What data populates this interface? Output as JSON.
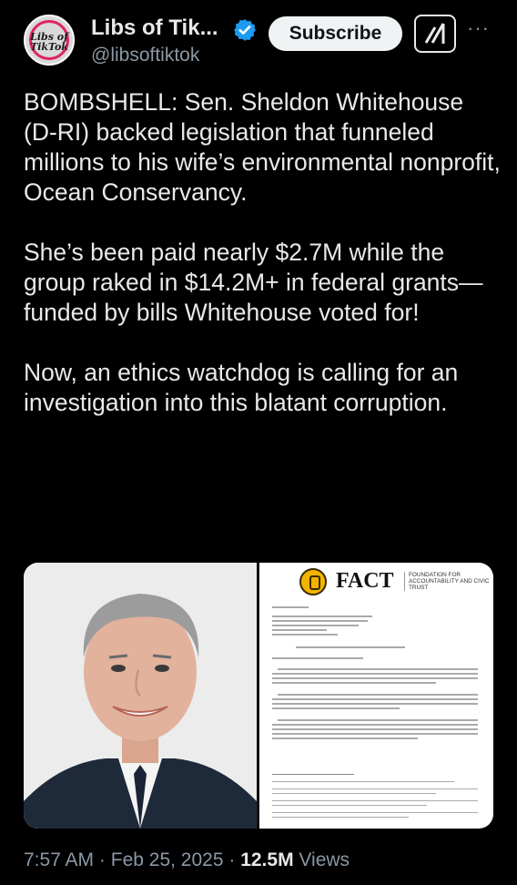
{
  "account": {
    "display_name": "Libs of Tik...",
    "handle": "@libsoftiktok",
    "avatar_text": "Libs of TikTok",
    "verified": true
  },
  "actions": {
    "subscribe_label": "Subscribe",
    "grok_icon": "grok-icon",
    "more_label": "···"
  },
  "tweet": {
    "paragraphs": [
      "BOMBSHELL: Sen. Sheldon Whitehouse (D-RI) backed legislation that funneled millions to his wife’s environmental nonprofit, Ocean Conservancy.",
      "She’s been paid nearly $2.7M while the group raked in $14.2M+ in federal grants—funded by bills Whitehouse voted for!",
      "Now, an ethics watchdog is calling for an investigation into this blatant corruption."
    ]
  },
  "media": {
    "photo_subject": "portrait-photo",
    "document": {
      "logo_word": "FACT",
      "logo_subtitle": "FOUNDATION FOR ACCOUNTABILITY AND CIVIC TRUST"
    }
  },
  "meta": {
    "time": "7:57 AM",
    "sep1": "·",
    "date": "Feb 25, 2025",
    "sep2": "·",
    "views_count": "12.5M",
    "views_label": "Views"
  },
  "colors": {
    "background": "#000000",
    "text": "#e7e9ea",
    "secondary": "#8b98a5",
    "verified": "#1d9bf0",
    "subscribe_bg": "#eff3f4"
  }
}
